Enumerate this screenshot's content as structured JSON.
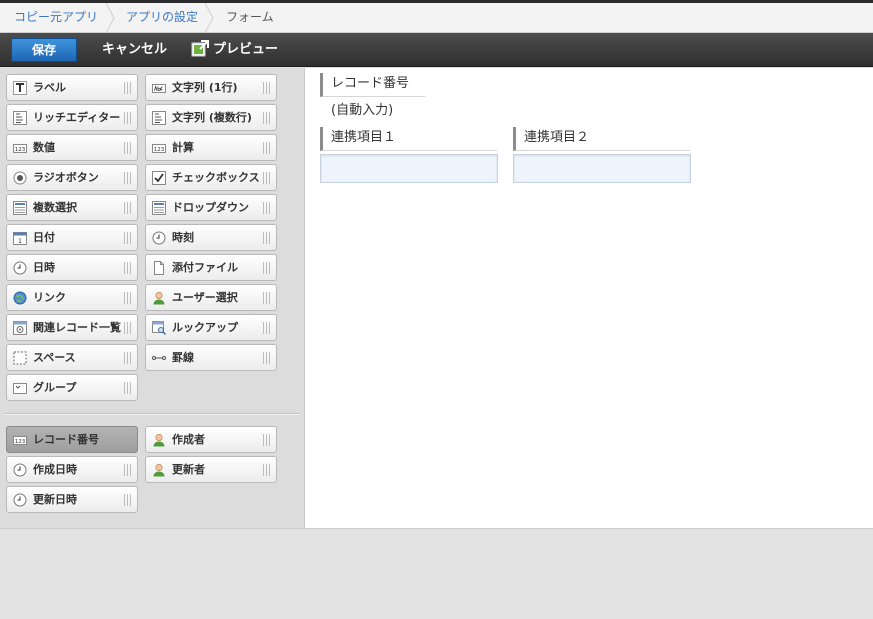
{
  "breadcrumb": {
    "items": [
      {
        "label": "コピー元アプリ"
      },
      {
        "label": "アプリの設定"
      },
      {
        "label": "フォーム"
      }
    ]
  },
  "toolbar": {
    "save_label": "保存",
    "cancel_label": "キャンセル",
    "preview_label": "プレビュー"
  },
  "palette": {
    "fields": [
      {
        "label": "ラベル",
        "icon": "label-icon"
      },
      {
        "label": "文字列 (1行)",
        "icon": "text-single-line-icon"
      },
      {
        "label": "リッチエディター",
        "icon": "rich-editor-icon"
      },
      {
        "label": "文字列 (複数行)",
        "icon": "text-multi-line-icon"
      },
      {
        "label": "数値",
        "icon": "number-icon"
      },
      {
        "label": "計算",
        "icon": "calc-icon"
      },
      {
        "label": "ラジオボタン",
        "icon": "radio-icon"
      },
      {
        "label": "チェックボックス",
        "icon": "checkbox-icon"
      },
      {
        "label": "複数選択",
        "icon": "multi-select-icon"
      },
      {
        "label": "ドロップダウン",
        "icon": "dropdown-icon"
      },
      {
        "label": "日付",
        "icon": "calendar-icon"
      },
      {
        "label": "時刻",
        "icon": "clock-icon"
      },
      {
        "label": "日時",
        "icon": "clock-icon"
      },
      {
        "label": "添付ファイル",
        "icon": "file-icon"
      },
      {
        "label": "リンク",
        "icon": "globe-icon"
      },
      {
        "label": "ユーザー選択",
        "icon": "user-icon"
      },
      {
        "label": "関連レコード一覧",
        "icon": "related-records-icon"
      },
      {
        "label": "ルックアップ",
        "icon": "lookup-icon"
      },
      {
        "label": "スペース",
        "icon": "space-icon"
      },
      {
        "label": "罫線",
        "icon": "line-icon"
      },
      {
        "label": "グループ",
        "icon": "group-icon"
      }
    ],
    "system_fields": [
      {
        "label": "レコード番号",
        "icon": "number-icon",
        "active": true
      },
      {
        "label": "作成者",
        "icon": "user-icon"
      },
      {
        "label": "作成日時",
        "icon": "clock-icon"
      },
      {
        "label": "更新者",
        "icon": "user-icon"
      },
      {
        "label": "更新日時",
        "icon": "clock-icon"
      }
    ]
  },
  "form": {
    "record_number": {
      "label": "レコード番号",
      "value": "(自動入力)"
    },
    "fields": [
      {
        "label": "連携項目１",
        "value": ""
      },
      {
        "label": "連携項目２",
        "value": ""
      }
    ]
  },
  "colors": {
    "accent": "#1d66b3",
    "link": "#3a78c2",
    "toolbar_bg": "#3a3a3a",
    "input_bg": "#eef4fb"
  }
}
